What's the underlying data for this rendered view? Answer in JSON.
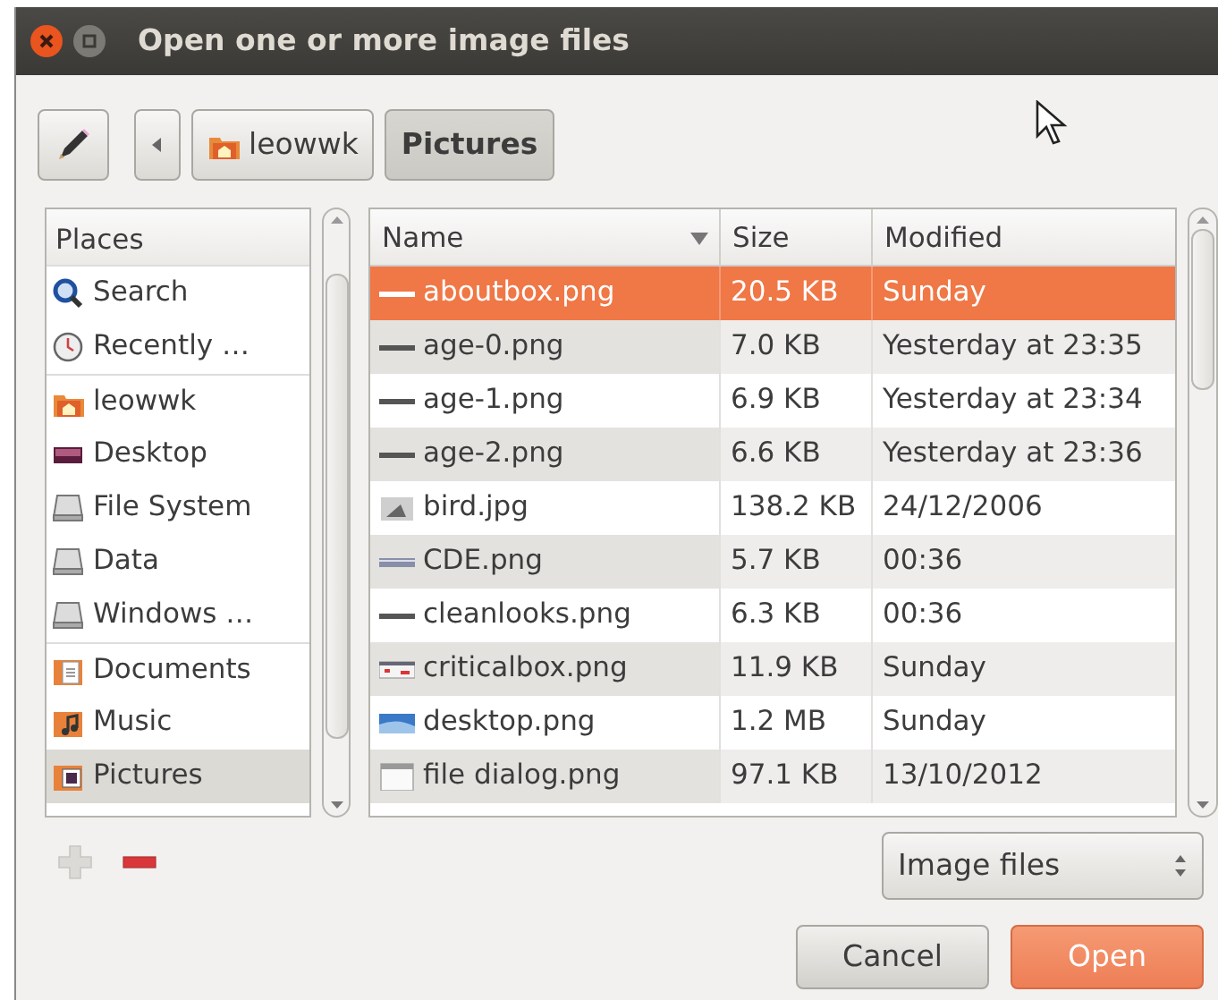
{
  "window": {
    "title": "Open one or more image files"
  },
  "path_buttons": [
    {
      "label": "leowwk",
      "kind": "home",
      "selected": false
    },
    {
      "label": "Pictures",
      "kind": "plain",
      "selected": true
    }
  ],
  "places": {
    "header": "Places",
    "items": [
      {
        "label": "Search",
        "kind": "search",
        "separator_before": false,
        "selected": false
      },
      {
        "label": "Recently …",
        "kind": "recent",
        "separator_before": false,
        "selected": false
      },
      {
        "label": "leowwk",
        "kind": "home",
        "separator_before": true,
        "selected": false
      },
      {
        "label": "Desktop",
        "kind": "desktop",
        "separator_before": false,
        "selected": false
      },
      {
        "label": "File System",
        "kind": "drive",
        "separator_before": false,
        "selected": false
      },
      {
        "label": "Data",
        "kind": "drive",
        "separator_before": false,
        "selected": false
      },
      {
        "label": "Windows …",
        "kind": "drive",
        "separator_before": false,
        "selected": false
      },
      {
        "label": "Documents",
        "kind": "documents",
        "separator_before": true,
        "selected": false
      },
      {
        "label": "Music",
        "kind": "music",
        "separator_before": false,
        "selected": false
      },
      {
        "label": "Pictures",
        "kind": "pictures",
        "separator_before": false,
        "selected": true
      }
    ],
    "add": {
      "disabled": true
    },
    "remove": {
      "disabled": false
    }
  },
  "files": {
    "columns": [
      {
        "label": "Name",
        "sorted": true
      },
      {
        "label": "Size",
        "sorted": false
      },
      {
        "label": "Modified",
        "sorted": false
      }
    ],
    "rows": [
      {
        "name": "aboutbox.png",
        "size": "20.5 KB",
        "modified": "Sunday",
        "kind": "strip",
        "selected": true
      },
      {
        "name": "age-0.png",
        "size": "7.0 KB",
        "modified": "Yesterday at 23:35",
        "kind": "strip",
        "selected": false
      },
      {
        "name": "age-1.png",
        "size": "6.9 KB",
        "modified": "Yesterday at 23:34",
        "kind": "strip",
        "selected": false
      },
      {
        "name": "age-2.png",
        "size": "6.6 KB",
        "modified": "Yesterday at 23:36",
        "kind": "strip",
        "selected": false
      },
      {
        "name": "bird.jpg",
        "size": "138.2 KB",
        "modified": "24/12/2006",
        "kind": "photo",
        "selected": false
      },
      {
        "name": "CDE.png",
        "size": "5.7 KB",
        "modified": "00:36",
        "kind": "bar",
        "selected": false
      },
      {
        "name": "cleanlooks.png",
        "size": "6.3 KB",
        "modified": "00:36",
        "kind": "strip",
        "selected": false
      },
      {
        "name": "criticalbox.png",
        "size": "11.9 KB",
        "modified": "Sunday",
        "kind": "alert",
        "selected": false
      },
      {
        "name": "desktop.png",
        "size": "1.2 MB",
        "modified": "Sunday",
        "kind": "screen",
        "selected": false
      },
      {
        "name": "file dialog.png",
        "size": "97.1 KB",
        "modified": "13/10/2012",
        "kind": "window",
        "selected": false
      }
    ]
  },
  "filter": {
    "value": "Image files"
  },
  "buttons": [
    {
      "label": "Cancel",
      "kind": "secondary"
    },
    {
      "label": "Open",
      "kind": "primary"
    }
  ]
}
